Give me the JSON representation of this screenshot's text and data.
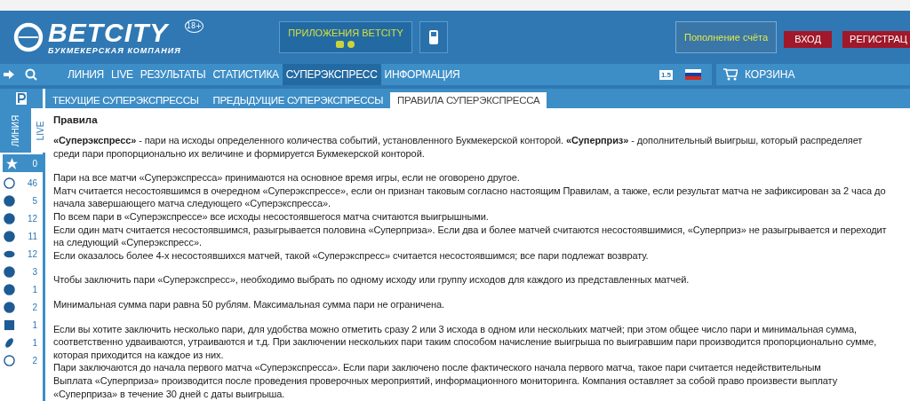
{
  "header": {
    "logo": {
      "name": "BETCITY",
      "tagline": "БУКМЕКЕРСКАЯ КОМПАНИЯ",
      "age": "18+"
    },
    "apps_button": "ПРИЛОЖЕНИЯ BETCITY",
    "deposit_button": "Пополнение счёта",
    "login_button": "ВХОД",
    "register_button": "РЕГИСТРАЦ"
  },
  "nav": {
    "items": [
      {
        "label": "ЛИНИЯ",
        "selected": false
      },
      {
        "label": "LIVE",
        "selected": false
      },
      {
        "label": "РЕЗУЛЬТАТЫ",
        "selected": false
      },
      {
        "label": "СТАТИСТИКА",
        "selected": false
      },
      {
        "label": "СУПЕРЭКСПРЕСС",
        "selected": true
      },
      {
        "label": "ИНФОРМАЦИЯ",
        "selected": false
      }
    ],
    "odds_format": "1.5",
    "cart": "КОРЗИНА"
  },
  "subnav": {
    "tabs": [
      {
        "label": "ТЕКУЩИЕ СУПЕРЭКСПРЕССЫ",
        "selected": false
      },
      {
        "label": "ПРЕДЫДУЩИЕ СУПЕРЭКСПРЕССЫ",
        "selected": false
      },
      {
        "label": "ПРАВИЛА СУПЕРЭКСПРЕССА",
        "selected": true
      }
    ]
  },
  "sidebar": {
    "tabs": [
      {
        "label": "ЛИНИЯ",
        "selected": true
      },
      {
        "label": "LIVE",
        "selected": false
      }
    ],
    "items": [
      {
        "count": "0",
        "selected": true
      },
      {
        "count": "46",
        "selected": false
      },
      {
        "count": "5",
        "selected": false
      },
      {
        "count": "12",
        "selected": false
      },
      {
        "count": "11",
        "selected": false
      },
      {
        "count": "12",
        "selected": false
      },
      {
        "count": "3",
        "selected": false
      },
      {
        "count": "1",
        "selected": false
      },
      {
        "count": "2",
        "selected": false
      },
      {
        "count": "1",
        "selected": false
      },
      {
        "count": "1",
        "selected": false
      },
      {
        "count": "2",
        "selected": false
      }
    ]
  },
  "content": {
    "title": "Правила",
    "paragraphs": [
      [
        "**«Суперэкспресс»** - пари на исходы определенного количества событий, установленного Букмекерской конторой. **«Суперприз»** - дополнительный выигрыш, который распределяет",
        "среди пари пропорционально их величине и формируется Букмекерской конторой."
      ],
      [
        "Пари на все матчи «Суперэкспресса» принимаются на основное время игры, если не оговорено другое.",
        "Матч считается несостоявшимся в очередном «Суперэкспрессе», если он признан таковым согласно настоящим Правилам, а также, если результат матча не зафиксирован за 2 часа до",
        "начала завершающего матча следующего «Суперэкспресса».",
        "По всем пари в «Суперэкспрессе» все исходы несостоявшегося матча считаются выигрышными.",
        "Если один матч считается несостоявшимся, разыгрывается половина «Суперприза». Если два и более матчей считаются несостоявшимися, «Суперприз» не разыгрывается и переходит",
        "на следующий «Суперэкспресс».",
        "Если оказалось более 4-х несостоявшихся матчей, такой «Суперэкспресс» считается несостоявшимся; все пари подлежат возврату."
      ],
      [
        "Чтобы заключить пари «Суперэкспресс», необходимо выбрать по одному исходу или группу исходов для каждого из представленных матчей."
      ],
      [
        "Минимальная сумма пари равна 50 рублям. Максимальная сумма пари не ограничена."
      ],
      [
        "Если вы хотите заключить несколько пари, для удобства можно отметить сразу 2 или 3 исхода в одном или нескольких матчей; при этом общее число пари и минимальная сумма,",
        "соответственно удваиваются, утраиваются и т.д. При заключении нескольких пари таким способом начисление выигрыша по выигравшим пари производится пропорционально сумме,",
        "которая приходится на каждое из них.",
        "Пари заключаются до начала первого матча «Суперэкспресса». Если пари заключено после фактического начала первого матча, такое пари считается недействительным",
        "Выплата «Суперприза» производится после проведения проверочных мероприятий, информационного мониторинга. Компания оставляет за собой право произвести выплату",
        "«Суперприза» в течение 30 дней с даты выигрыша."
      ]
    ]
  }
}
